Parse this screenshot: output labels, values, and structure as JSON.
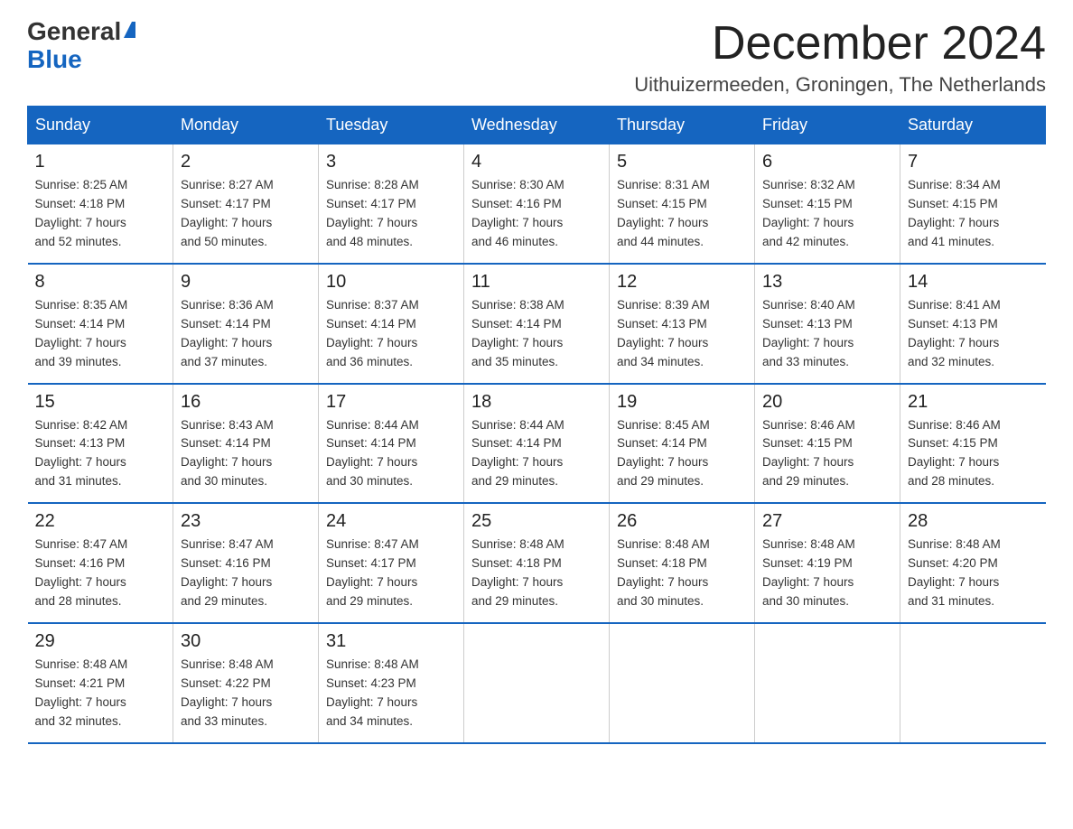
{
  "logo": {
    "general": "General",
    "blue": "Blue"
  },
  "header": {
    "month": "December 2024",
    "location": "Uithuizermeeden, Groningen, The Netherlands"
  },
  "weekdays": [
    "Sunday",
    "Monday",
    "Tuesday",
    "Wednesday",
    "Thursday",
    "Friday",
    "Saturday"
  ],
  "weeks": [
    [
      {
        "day": "1",
        "sunrise": "8:25 AM",
        "sunset": "4:18 PM",
        "daylight": "7 hours and 52 minutes."
      },
      {
        "day": "2",
        "sunrise": "8:27 AM",
        "sunset": "4:17 PM",
        "daylight": "7 hours and 50 minutes."
      },
      {
        "day": "3",
        "sunrise": "8:28 AM",
        "sunset": "4:17 PM",
        "daylight": "7 hours and 48 minutes."
      },
      {
        "day": "4",
        "sunrise": "8:30 AM",
        "sunset": "4:16 PM",
        "daylight": "7 hours and 46 minutes."
      },
      {
        "day": "5",
        "sunrise": "8:31 AM",
        "sunset": "4:15 PM",
        "daylight": "7 hours and 44 minutes."
      },
      {
        "day": "6",
        "sunrise": "8:32 AM",
        "sunset": "4:15 PM",
        "daylight": "7 hours and 42 minutes."
      },
      {
        "day": "7",
        "sunrise": "8:34 AM",
        "sunset": "4:15 PM",
        "daylight": "7 hours and 41 minutes."
      }
    ],
    [
      {
        "day": "8",
        "sunrise": "8:35 AM",
        "sunset": "4:14 PM",
        "daylight": "7 hours and 39 minutes."
      },
      {
        "day": "9",
        "sunrise": "8:36 AM",
        "sunset": "4:14 PM",
        "daylight": "7 hours and 37 minutes."
      },
      {
        "day": "10",
        "sunrise": "8:37 AM",
        "sunset": "4:14 PM",
        "daylight": "7 hours and 36 minutes."
      },
      {
        "day": "11",
        "sunrise": "8:38 AM",
        "sunset": "4:14 PM",
        "daylight": "7 hours and 35 minutes."
      },
      {
        "day": "12",
        "sunrise": "8:39 AM",
        "sunset": "4:13 PM",
        "daylight": "7 hours and 34 minutes."
      },
      {
        "day": "13",
        "sunrise": "8:40 AM",
        "sunset": "4:13 PM",
        "daylight": "7 hours and 33 minutes."
      },
      {
        "day": "14",
        "sunrise": "8:41 AM",
        "sunset": "4:13 PM",
        "daylight": "7 hours and 32 minutes."
      }
    ],
    [
      {
        "day": "15",
        "sunrise": "8:42 AM",
        "sunset": "4:13 PM",
        "daylight": "7 hours and 31 minutes."
      },
      {
        "day": "16",
        "sunrise": "8:43 AM",
        "sunset": "4:14 PM",
        "daylight": "7 hours and 30 minutes."
      },
      {
        "day": "17",
        "sunrise": "8:44 AM",
        "sunset": "4:14 PM",
        "daylight": "7 hours and 30 minutes."
      },
      {
        "day": "18",
        "sunrise": "8:44 AM",
        "sunset": "4:14 PM",
        "daylight": "7 hours and 29 minutes."
      },
      {
        "day": "19",
        "sunrise": "8:45 AM",
        "sunset": "4:14 PM",
        "daylight": "7 hours and 29 minutes."
      },
      {
        "day": "20",
        "sunrise": "8:46 AM",
        "sunset": "4:15 PM",
        "daylight": "7 hours and 29 minutes."
      },
      {
        "day": "21",
        "sunrise": "8:46 AM",
        "sunset": "4:15 PM",
        "daylight": "7 hours and 28 minutes."
      }
    ],
    [
      {
        "day": "22",
        "sunrise": "8:47 AM",
        "sunset": "4:16 PM",
        "daylight": "7 hours and 28 minutes."
      },
      {
        "day": "23",
        "sunrise": "8:47 AM",
        "sunset": "4:16 PM",
        "daylight": "7 hours and 29 minutes."
      },
      {
        "day": "24",
        "sunrise": "8:47 AM",
        "sunset": "4:17 PM",
        "daylight": "7 hours and 29 minutes."
      },
      {
        "day": "25",
        "sunrise": "8:48 AM",
        "sunset": "4:18 PM",
        "daylight": "7 hours and 29 minutes."
      },
      {
        "day": "26",
        "sunrise": "8:48 AM",
        "sunset": "4:18 PM",
        "daylight": "7 hours and 30 minutes."
      },
      {
        "day": "27",
        "sunrise": "8:48 AM",
        "sunset": "4:19 PM",
        "daylight": "7 hours and 30 minutes."
      },
      {
        "day": "28",
        "sunrise": "8:48 AM",
        "sunset": "4:20 PM",
        "daylight": "7 hours and 31 minutes."
      }
    ],
    [
      {
        "day": "29",
        "sunrise": "8:48 AM",
        "sunset": "4:21 PM",
        "daylight": "7 hours and 32 minutes."
      },
      {
        "day": "30",
        "sunrise": "8:48 AM",
        "sunset": "4:22 PM",
        "daylight": "7 hours and 33 minutes."
      },
      {
        "day": "31",
        "sunrise": "8:48 AM",
        "sunset": "4:23 PM",
        "daylight": "7 hours and 34 minutes."
      },
      null,
      null,
      null,
      null
    ]
  ],
  "labels": {
    "sunrise": "Sunrise:",
    "sunset": "Sunset:",
    "daylight": "Daylight:"
  }
}
